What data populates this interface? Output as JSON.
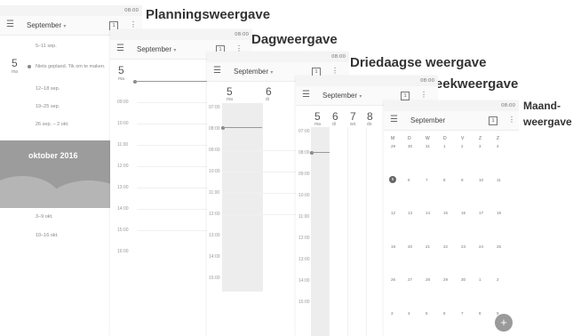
{
  "titles": {
    "planning": "Planningsweergave",
    "day": "Dagweergave",
    "three_day": "Driedaagse weergave",
    "week": "Weekweergave",
    "month_line1": "Maand-",
    "month_line2": "weergave"
  },
  "status_time": "08:00",
  "toolbar": {
    "month": "September",
    "caret": "▾",
    "today": "1",
    "more": "⋮",
    "menu": "☰"
  },
  "planning": {
    "weeks": [
      "5–11 sep.",
      "12–18 sep.",
      "19–25 sep.",
      "26 sep. – 2 okt."
    ],
    "today_num": "5",
    "today_wd": "ma",
    "empty_text": "Niets gepland. Tik om te maken.",
    "banner": "oktober 2016",
    "after_weeks": [
      "3–9 okt.",
      "10–16 okt."
    ]
  },
  "day_view": {
    "day_num": "5",
    "day_wd": "ma",
    "times": [
      "09:00",
      "10:00",
      "11:00",
      "12:00",
      "13:00",
      "14:00",
      "15:00",
      "16:00"
    ]
  },
  "three_day_view": {
    "days": [
      {
        "num": "5",
        "wd": "ma"
      },
      {
        "num": "6",
        "wd": "di"
      }
    ],
    "times": [
      "07:00",
      "08:00",
      "09:00",
      "10:00",
      "11:00",
      "12:00",
      "13:00",
      "14:00",
      "15:00"
    ]
  },
  "week_view": {
    "days": [
      {
        "num": "5",
        "wd": "ma"
      },
      {
        "num": "6",
        "wd": "di"
      },
      {
        "num": "7",
        "wd": "wo"
      },
      {
        "num": "8",
        "wd": "do"
      }
    ],
    "times": [
      "07:00",
      "08:00",
      "09:00",
      "10:00",
      "11:00",
      "12:00",
      "13:00",
      "14:00",
      "15:00"
    ]
  },
  "month_view": {
    "headers": [
      "M",
      "D",
      "W",
      "D",
      "V",
      "Z",
      "Z"
    ],
    "rows": [
      [
        "29",
        "30",
        "31",
        "1",
        "2",
        "3",
        "4"
      ],
      [
        "5",
        "6",
        "7",
        "8",
        "9",
        "10",
        "11"
      ],
      [
        "12",
        "13",
        "14",
        "15",
        "16",
        "17",
        "18"
      ],
      [
        "19",
        "20",
        "21",
        "22",
        "23",
        "24",
        "25"
      ],
      [
        "26",
        "27",
        "28",
        "29",
        "30",
        "1",
        "2"
      ],
      [
        "3",
        "4",
        "5",
        "6",
        "7",
        "8",
        "9"
      ]
    ],
    "fab": "+"
  }
}
